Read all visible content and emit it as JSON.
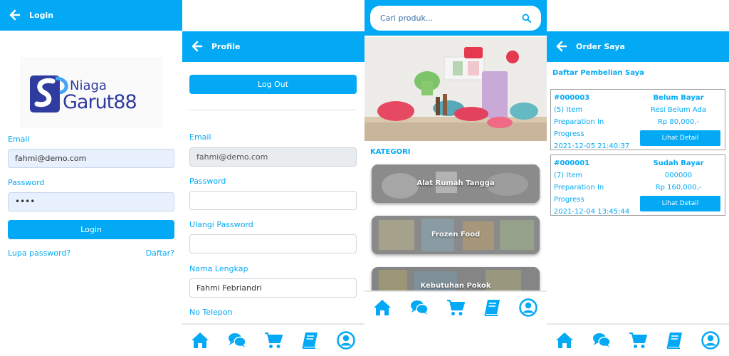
{
  "colors": {
    "accent": "#03a9f4",
    "logo_blue": "#2f3b9e",
    "logo_light": "#42a5f5"
  },
  "login": {
    "header_title": "Login",
    "logo_text_top": "Niaga",
    "logo_text_bottom": "Garut88",
    "email_label": "Email",
    "email_value": "fahmi@demo.com",
    "password_label": "Password",
    "password_value": "••••",
    "login_button": "Login",
    "forgot_link": "Lupa password?",
    "register_link": "Daftar?"
  },
  "profile": {
    "header_title": "Profile",
    "logout_button": "Log Out",
    "email_label": "Email",
    "email_value": "fahmi@demo.com",
    "password_label": "Password",
    "password_value": "",
    "repeat_password_label": "Ulangi Password",
    "repeat_password_value": "",
    "fullname_label": "Nama Lengkap",
    "fullname_value": "Fahmi Febriandri",
    "phone_label": "No Telepon"
  },
  "home": {
    "search_placeholder": "Cari produk...",
    "category_heading": "KATEGORI",
    "categories": [
      "Alat Rumah Tangga",
      "Frozen Food",
      "Kebutuhan Pokok"
    ]
  },
  "orders": {
    "header_title": "Order Saya",
    "section_title": "Daftar Pembelian Saya",
    "items": [
      {
        "id": "#000003",
        "count": "(5) Item",
        "status_line1": "Preparation In",
        "status_line2": "Progress",
        "date": "2021-12-05 21:40:37",
        "pay_status": "Belum Bayar",
        "receipt": "Resi Belum Ada",
        "total": "Rp 80,000,-",
        "detail_button": "Lihat Detail"
      },
      {
        "id": "#000001",
        "count": "(7) Item",
        "status_line1": "Preparation In",
        "status_line2": "Progress",
        "date": "2021-12-04 13:45:44",
        "pay_status": "Sudah Bayar",
        "receipt": "000000",
        "total": "Rp 160,000,-",
        "detail_button": "Lihat Detail"
      }
    ]
  },
  "bottom_nav": [
    "home-icon",
    "chat-icon",
    "cart-icon",
    "book-icon",
    "account-icon"
  ]
}
